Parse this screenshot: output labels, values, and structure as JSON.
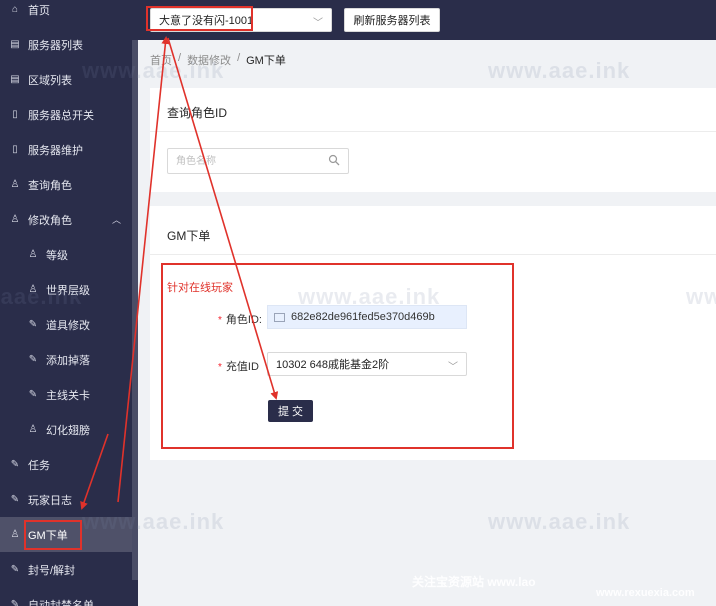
{
  "sidebar": {
    "items": [
      {
        "label": "首页",
        "icon": "home-icon",
        "glyph": "⌂"
      },
      {
        "label": "服务器列表",
        "icon": "list-icon",
        "glyph": "▤"
      },
      {
        "label": "区域列表",
        "icon": "list-icon",
        "glyph": "▤"
      },
      {
        "label": "服务器总开关",
        "icon": "phone-icon",
        "glyph": "▯"
      },
      {
        "label": "服务器维护",
        "icon": "phone-icon",
        "glyph": "▯"
      },
      {
        "label": "查询角色",
        "icon": "user-icon",
        "glyph": "♙"
      },
      {
        "label": "修改角色",
        "icon": "user-icon",
        "glyph": "♙",
        "expanded": true
      },
      {
        "label": "等级",
        "icon": "user-icon",
        "glyph": "♙",
        "sub": true
      },
      {
        "label": "世界层级",
        "icon": "user-icon",
        "glyph": "♙",
        "sub": true
      },
      {
        "label": "道具修改",
        "icon": "wrench-icon",
        "glyph": "✎",
        "sub": true
      },
      {
        "label": "添加掉落",
        "icon": "wrench-icon",
        "glyph": "✎",
        "sub": true
      },
      {
        "label": "主线关卡",
        "icon": "wrench-icon",
        "glyph": "✎",
        "sub": true
      },
      {
        "label": "幻化翅膀",
        "icon": "user-icon",
        "glyph": "♙",
        "sub": true
      },
      {
        "label": "任务",
        "icon": "wrench-icon",
        "glyph": "✎"
      },
      {
        "label": "玩家日志",
        "icon": "wrench-icon",
        "glyph": "✎"
      },
      {
        "label": "GM下单",
        "icon": "user-icon",
        "glyph": "♙",
        "active": true
      },
      {
        "label": "封号/解封",
        "icon": "edit-icon",
        "glyph": "✎"
      },
      {
        "label": "自动封禁名单",
        "icon": "wrench-icon",
        "glyph": "✎"
      }
    ]
  },
  "header": {
    "server_select": "大意了没有闪-1001",
    "refresh_label": "刷新服务器列表"
  },
  "breadcrumb": [
    "首页",
    "数据修改",
    "GM下单"
  ],
  "query": {
    "title": "查询角色ID",
    "placeholder": "角色名称"
  },
  "gm_order": {
    "title": "GM下单",
    "section": "针对在线玩家",
    "role_id_label": "角色ID:",
    "role_id_value": "682e82de961fed5e370d469b",
    "recharge_label": "充值ID",
    "recharge_value": "10302 648戚能基金2阶",
    "submit_label": "提 交"
  },
  "watermarks": {
    "site": "www.aae.ink",
    "footer_left": "关注宝资源站 www.lao",
    "footer_right": "www.rexuexia.com"
  },
  "colors": {
    "sidebar_bg": "#2a2d4a",
    "highlight": "#e0322b"
  }
}
